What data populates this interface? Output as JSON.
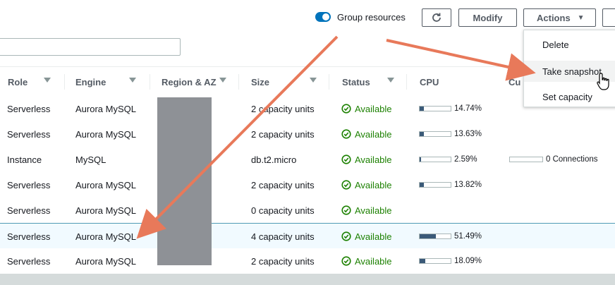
{
  "toolbar": {
    "group_resources_label": "Group resources",
    "group_resources_on": true,
    "refresh_icon": "refresh-icon",
    "modify_label": "Modify",
    "actions_label": "Actions",
    "accent": "#0073bb"
  },
  "search": {
    "value": "",
    "placeholder": ""
  },
  "table": {
    "headers": [
      "Role",
      "Engine",
      "Region & AZ",
      "Size",
      "Status",
      "CPU",
      "Cu"
    ],
    "rows": [
      {
        "role": "Serverless",
        "engine": "Aurora MySQL",
        "size": "2 capacity units",
        "status": "Available",
        "cpu": "14.74%",
        "cpu_frac": 0.1474,
        "connections": ""
      },
      {
        "role": "Serverless",
        "engine": "Aurora MySQL",
        "size": "2 capacity units",
        "status": "Available",
        "cpu": "13.63%",
        "cpu_frac": 0.1363,
        "connections": ""
      },
      {
        "role": "Instance",
        "engine": "MySQL",
        "size": "db.t2.micro",
        "status": "Available",
        "cpu": "2.59%",
        "cpu_frac": 0.0259,
        "connections": "0 Connections"
      },
      {
        "role": "Serverless",
        "engine": "Aurora MySQL",
        "size": "2 capacity units",
        "status": "Available",
        "cpu": "13.82%",
        "cpu_frac": 0.1382,
        "connections": ""
      },
      {
        "role": "Serverless",
        "engine": "Aurora MySQL",
        "size": "0 capacity units",
        "status": "Available",
        "cpu": "",
        "cpu_frac": null,
        "connections": ""
      },
      {
        "role": "Serverless",
        "engine": "Aurora MySQL",
        "size": "4 capacity units",
        "status": "Available",
        "cpu": "51.49%",
        "cpu_frac": 0.5149,
        "connections": "",
        "selected": true
      },
      {
        "role": "Serverless",
        "engine": "Aurora MySQL",
        "size": "2 capacity units",
        "status": "Available",
        "cpu": "18.09%",
        "cpu_frac": 0.1809,
        "connections": ""
      }
    ],
    "status_color": "#1d8102"
  },
  "actions_menu": {
    "items": [
      "Delete",
      "Take snapshot",
      "Set capacity"
    ],
    "hovered": "Take snapshot"
  },
  "annotation_arrow_color": "#e8795a"
}
